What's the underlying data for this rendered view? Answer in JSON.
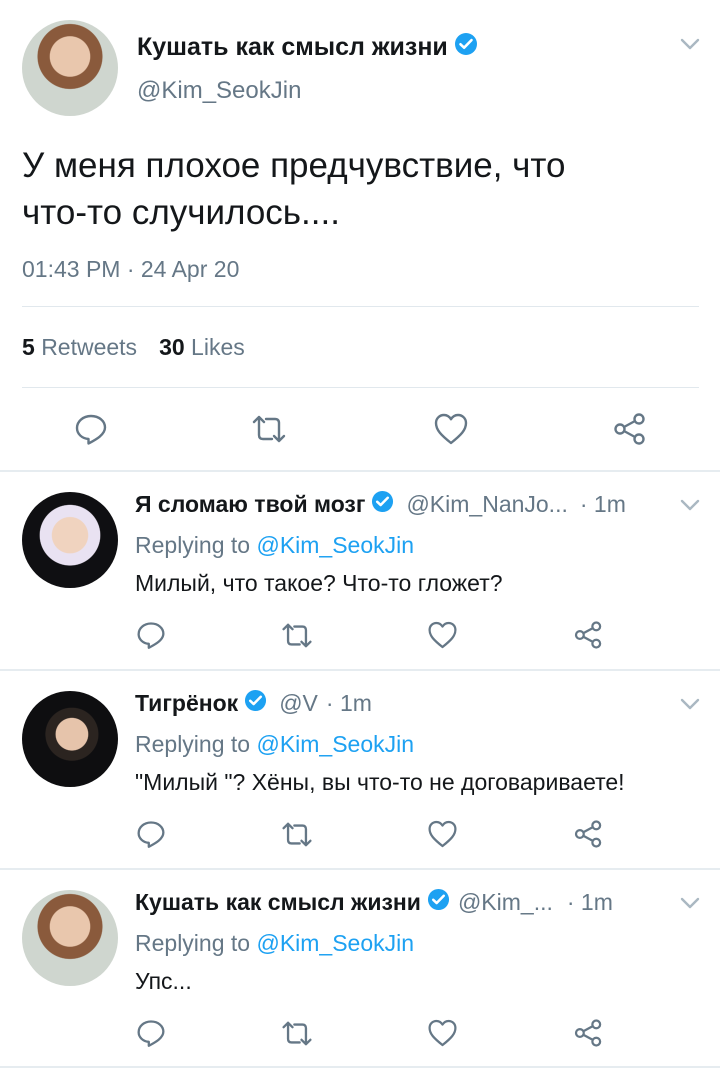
{
  "main_tweet": {
    "author_name": "Кушать как смысл жизни",
    "author_handle": "@Kim_SeokJin",
    "text_line1": "У меня плохое предчувствие, что",
    "text_line2": "что-то случилось....",
    "timestamp": "01:43 PM · 24 Apr 20",
    "retweets_count": "5",
    "retweets_label": "Retweets",
    "likes_count": "30",
    "likes_label": "Likes"
  },
  "replies": [
    {
      "author_name": "Я сломаю твой мозг",
      "author_handle": "@Kim_NanJo...",
      "time": "· 1m",
      "replying_prefix": "Replying to",
      "replying_to": "@Kim_SeokJin",
      "text": "Милый, что такое? Что-то гложет?"
    },
    {
      "author_name": "Тигрёнок",
      "author_handle": "@V",
      "time": "· 1m",
      "replying_prefix": "Replying to",
      "replying_to": "@Kim_SeokJin",
      "text": "\"Милый \"? Хёны, вы что-то не договариваете!"
    },
    {
      "author_name": "Кушать как смысл жизни",
      "author_handle": "@Kim_...",
      "time": "· 1m",
      "replying_prefix": "Replying to",
      "replying_to": "@Kim_SeokJin",
      "text": "Упс..."
    }
  ],
  "colors": {
    "accent": "#1da1f2",
    "muted": "#657786",
    "icon": "#657786",
    "divider": "#e1e8ed"
  },
  "icons": [
    "verified-badge-icon",
    "chevron-down-icon",
    "reply-icon",
    "retweet-icon",
    "like-icon",
    "share-icon"
  ]
}
